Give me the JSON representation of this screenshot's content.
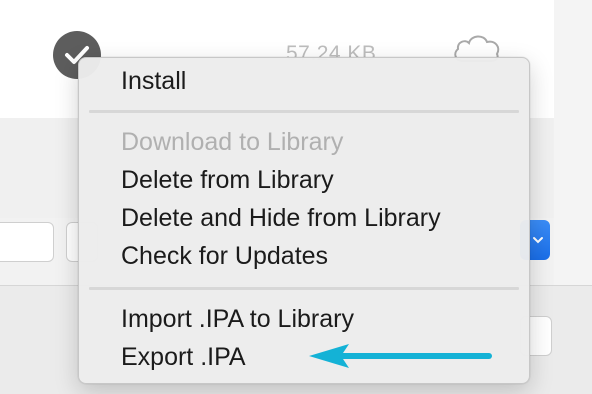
{
  "background": {
    "file_size": "57.24 KB",
    "icons": {
      "status": "checkmark-icon",
      "download": "cloud-download-icon",
      "button": "chevron-down-icon"
    }
  },
  "context_menu": {
    "groups": [
      [
        {
          "label": "Install",
          "enabled": true
        }
      ],
      [
        {
          "label": "Download to Library",
          "enabled": false
        },
        {
          "label": "Delete from Library",
          "enabled": true
        },
        {
          "label": "Delete and Hide from Library",
          "enabled": true
        },
        {
          "label": "Check for Updates",
          "enabled": true
        }
      ],
      [
        {
          "label": "Import .IPA to Library",
          "enabled": true
        },
        {
          "label": "Export .IPA",
          "enabled": true
        }
      ]
    ]
  },
  "annotation": {
    "type": "arrow-icon",
    "color": "#14b2d6",
    "points_to": "Export .IPA"
  },
  "colors": {
    "menu_text": "#1b1b1b",
    "menu_disabled_text": "#b0b0b0",
    "accent_blue": "#1a6ee8"
  }
}
